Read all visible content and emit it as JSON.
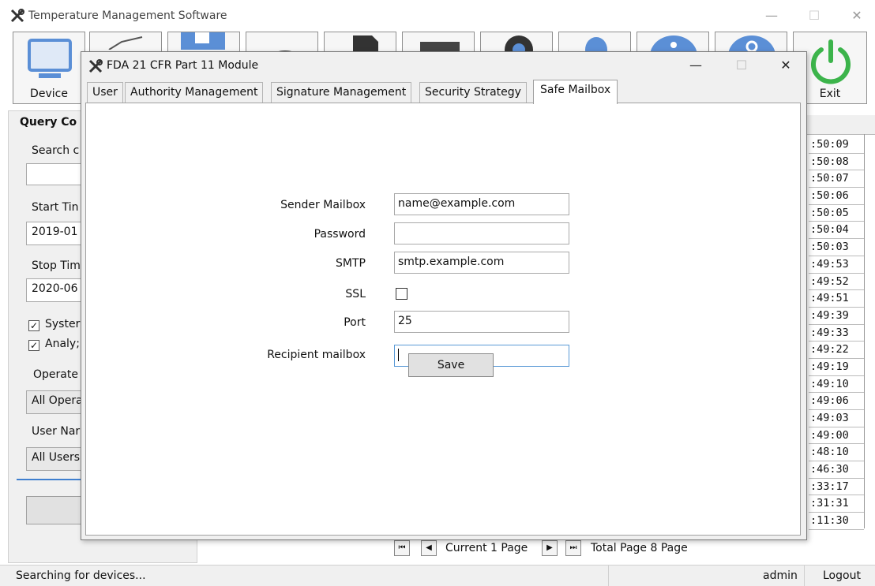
{
  "app": {
    "title": "Temperature Management Software",
    "toolbar": {
      "device_label": "Device",
      "exit_label": "Exit"
    }
  },
  "query_panel": {
    "title": "Query Co",
    "search_label": "Search c",
    "start_time_label": "Start Tin",
    "start_time_value": "2019-01",
    "stop_time_label": "Stop Tim",
    "stop_time_value": "2020-06",
    "checkbox_system_label": "Syster",
    "checkbox_analyze_label": "Analy;",
    "operate_label": "Operate",
    "operate_value": "All Opera",
    "user_name_label": "User Nar",
    "user_name_value": "All Users"
  },
  "log_times": [
    ":50:09",
    ":50:08",
    ":50:07",
    ":50:06",
    ":50:05",
    ":50:04",
    ":50:03",
    ":49:53",
    ":49:52",
    ":49:51",
    ":49:39",
    ":49:33",
    ":49:22",
    ":49:19",
    ":49:10",
    ":49:06",
    ":49:03",
    ":49:00",
    ":48:10",
    ":46:30",
    ":33:17",
    ":31:31",
    ":11:30"
  ],
  "pagination": {
    "current_label": "Current 1 Page",
    "total_label": "Total Page 8 Page"
  },
  "status_bar": {
    "status_text": "Searching for devices...",
    "user": "admin",
    "logout_label": "Logout"
  },
  "dialog": {
    "title": "FDA 21 CFR Part 11 Module",
    "tabs": [
      "User",
      "Authority Management",
      "Signature Management",
      "Security Strategy",
      "Safe Mailbox"
    ],
    "active_tab": "Safe Mailbox",
    "form": {
      "sender_mailbox_label": "Sender Mailbox",
      "sender_mailbox_value": "name@example.com",
      "password_label": "Password",
      "password_value": "",
      "smtp_label": "SMTP",
      "smtp_value": "smtp.example.com",
      "ssl_label": "SSL",
      "ssl_checked": false,
      "port_label": "Port",
      "port_value": "25",
      "recipient_label": "Recipient mailbox",
      "recipient_value": "",
      "save_label": "Save"
    }
  },
  "colors": {
    "device_icon": "#5b8fd6",
    "exit_icon": "#3cb44b",
    "accent_blue": "#3f7fcf",
    "focus_border": "#5a9ad6"
  }
}
